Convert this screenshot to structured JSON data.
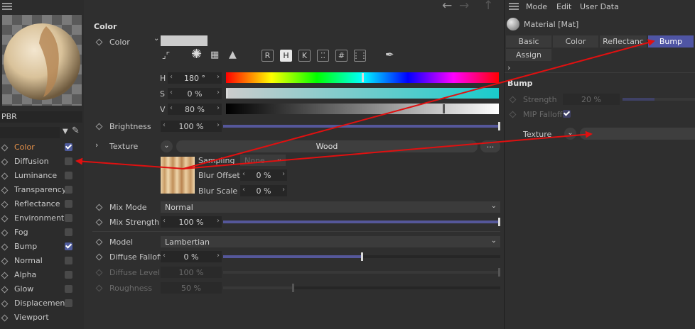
{
  "left_panel": {
    "material_name": "PBR",
    "search_value": "",
    "channels": [
      {
        "label": "Color",
        "checked": true,
        "active": true
      },
      {
        "label": "Diffusion",
        "checked": false
      },
      {
        "label": "Luminance",
        "checked": false
      },
      {
        "label": "Transparency",
        "checked": false
      },
      {
        "label": "Reflectance",
        "checked": false
      },
      {
        "label": "Environment",
        "checked": false
      },
      {
        "label": "Fog",
        "checked": false
      },
      {
        "label": "Bump",
        "checked": true
      },
      {
        "label": "Normal",
        "checked": false
      },
      {
        "label": "Alpha",
        "checked": false
      },
      {
        "label": "Glow",
        "checked": false
      },
      {
        "label": "Displacement",
        "checked": false
      },
      {
        "label": "Viewport",
        "checked": null
      }
    ]
  },
  "center": {
    "section_title": "Color",
    "color_label": "Color",
    "h_label": "H",
    "h_value": "180 °",
    "s_label": "S",
    "s_value": "0 %",
    "v_label": "V",
    "v_value": "80 %",
    "h_level": 0.5,
    "s_level": 0.0,
    "v_level": 0.8,
    "mode_buttons": [
      "R",
      "H",
      "K",
      "⁚⁚",
      "#",
      "⋮⋮"
    ],
    "selected_mode": "H",
    "brightness_label": "Brightness",
    "brightness_value": "100 %",
    "texture_label": "Texture",
    "texture_name": "Wood",
    "texture_more": "...",
    "sampling_label": "Sampling",
    "sampling_value": "None",
    "blur_offset_label": "Blur Offset",
    "blur_offset_value": "0 %",
    "blur_scale_label": "Blur Scale",
    "blur_scale_value": "0 %",
    "mix_mode_label": "Mix Mode",
    "mix_mode_value": "Normal",
    "mix_strength_label": "Mix Strength",
    "mix_strength_value": "100 %",
    "model_label": "Model",
    "model_value": "Lambertian",
    "diffuse_falloff_label": "Diffuse Falloff",
    "diffuse_falloff_value": "0 %",
    "diffuse_level_label": "Diffuse Level",
    "diffuse_level_value": "100 %",
    "roughness_label": "Roughness",
    "roughness_value": "50 %",
    "brightness_level": 1.0,
    "mix_strength_level": 1.0,
    "diffuse_falloff_level": 0.5,
    "diffuse_level_level": 1.0,
    "roughness_level": 0.25
  },
  "right_panel": {
    "menu": [
      "Mode",
      "Edit",
      "User Data"
    ],
    "material_title": "Material [Mat]",
    "tabs": [
      "Basic",
      "Color",
      "Reflectanc",
      "Bump"
    ],
    "active_tab": "Bump",
    "tab_assign": "Assign",
    "section_title": "Bump",
    "strength_label": "Strength",
    "strength_value": "20 %",
    "strength_level": 0.2,
    "mip_falloff_label": "MIP Falloff",
    "texture_label": "Texture"
  },
  "colors": {
    "accent": "#4f55a4",
    "active_channel": "#e8924a",
    "annotation_arrow": "#e01010"
  }
}
